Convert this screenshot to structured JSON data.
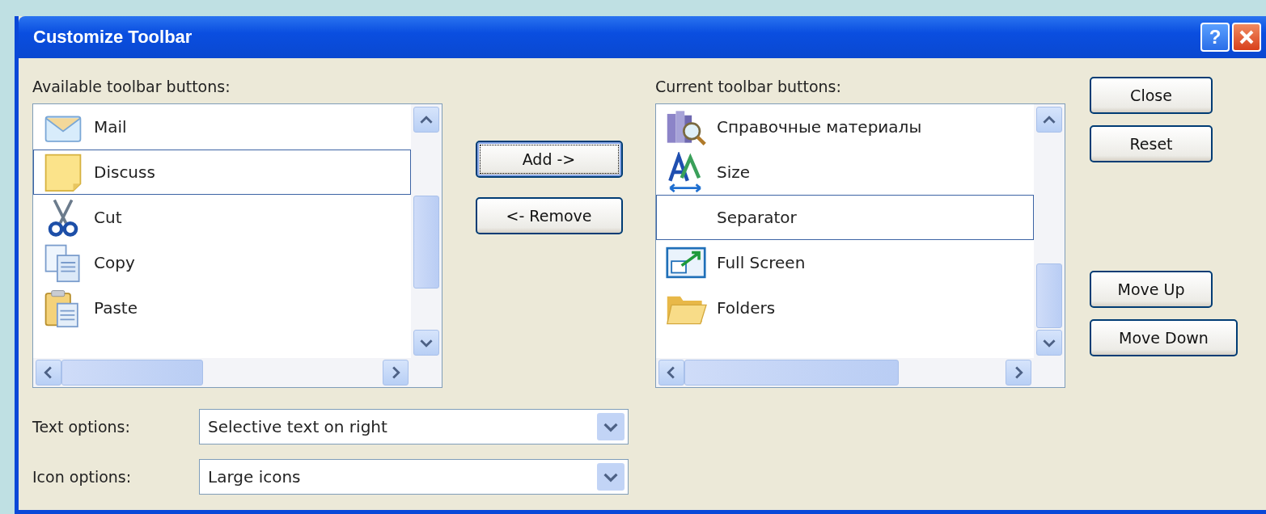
{
  "window": {
    "title": "Customize Toolbar",
    "help_button": "?"
  },
  "available": {
    "label": "Available toolbar buttons:",
    "items": [
      {
        "label": "Mail",
        "kind": "mail",
        "selected": false
      },
      {
        "label": "Discuss",
        "kind": "note",
        "selected": true
      },
      {
        "label": "Cut",
        "kind": "scissors",
        "selected": false
      },
      {
        "label": "Copy",
        "kind": "copy",
        "selected": false
      },
      {
        "label": "Paste",
        "kind": "paste",
        "selected": false
      }
    ]
  },
  "transfer_buttons": [
    {
      "label": "Add ->",
      "focused": true
    },
    {
      "label": "<- Remove",
      "focused": false
    }
  ],
  "current": {
    "label": "Current toolbar buttons:",
    "items": [
      {
        "label": "Справочные материалы",
        "kind": "books",
        "selected": false
      },
      {
        "label": "Size",
        "kind": "size",
        "selected": false
      },
      {
        "label": "Separator",
        "kind": "separator",
        "selected": true
      },
      {
        "label": "Full Screen",
        "kind": "fullscreen",
        "selected": false
      },
      {
        "label": "Folders",
        "kind": "folder",
        "selected": false
      }
    ]
  },
  "side_buttons": {
    "top": [
      "Close",
      "Reset"
    ],
    "bottom": [
      "Move Up",
      "Move Down"
    ]
  },
  "options": [
    {
      "label": "Text options:",
      "value": "Selective text on right"
    },
    {
      "label": "Icon options:",
      "value": "Large icons"
    }
  ]
}
